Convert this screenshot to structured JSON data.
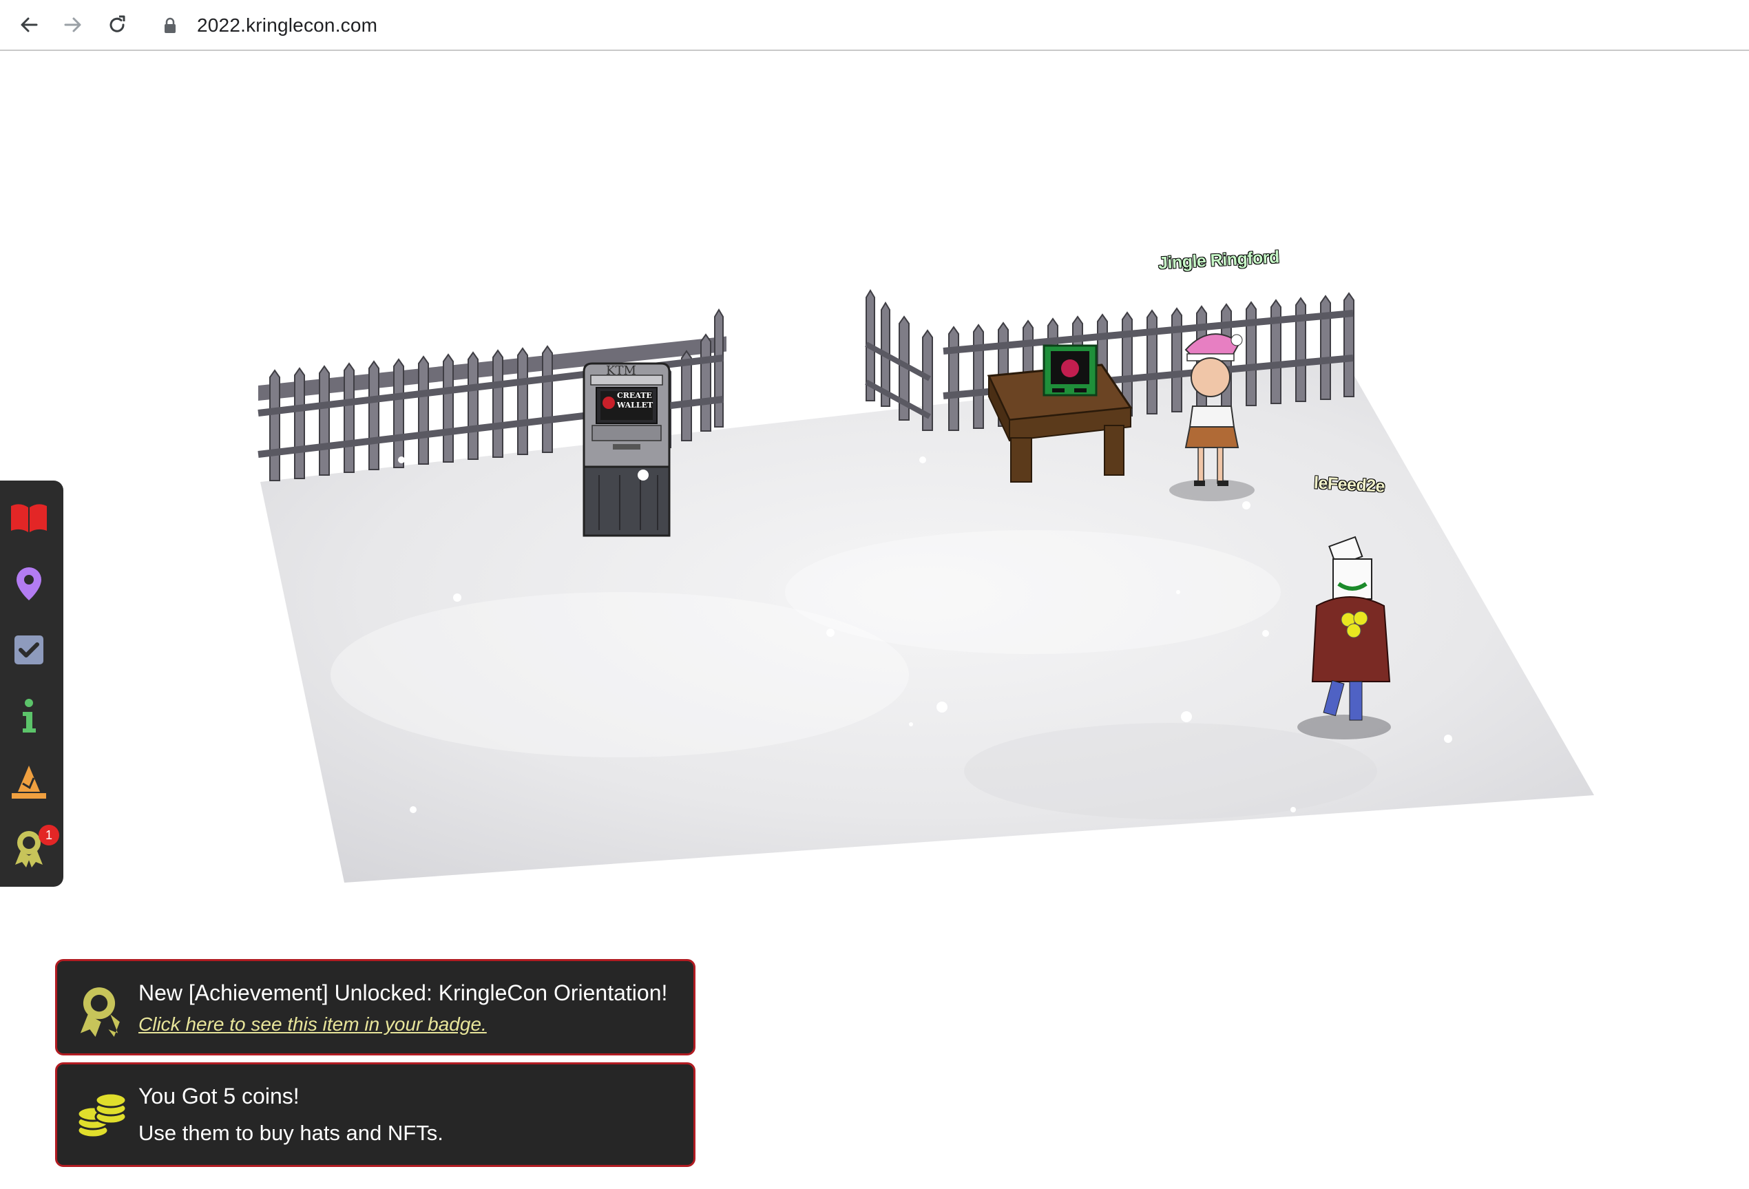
{
  "browser": {
    "url": "2022.kringlecon.com"
  },
  "scene": {
    "npc_name": "Jingle Ringford",
    "player_name": "leFeed2e",
    "atm": {
      "header": "KTM",
      "screen_line1": "CREATE",
      "screen_line2": "WALLET"
    }
  },
  "sidebar": {
    "items": [
      {
        "icon": "book-icon",
        "color": "#e32626"
      },
      {
        "icon": "map-pin-icon",
        "color": "#b37cf2"
      },
      {
        "icon": "checkbox-icon",
        "color": "#8e9bbd"
      },
      {
        "icon": "info-icon",
        "color": "#5cc46a"
      },
      {
        "icon": "hat-icon",
        "color": "#f0a040"
      },
      {
        "icon": "badge-icon",
        "color": "#c7c45a"
      }
    ],
    "badge_count": "1"
  },
  "notifications": [
    {
      "icon": "achievement-badge-icon",
      "title": "New [Achievement] Unlocked: KringleCon Orientation!",
      "link": "Click here to see this item in your badge."
    },
    {
      "icon": "coins-icon",
      "title": "You Got 5 coins!",
      "body": "Use them to buy hats and NFTs."
    }
  ]
}
